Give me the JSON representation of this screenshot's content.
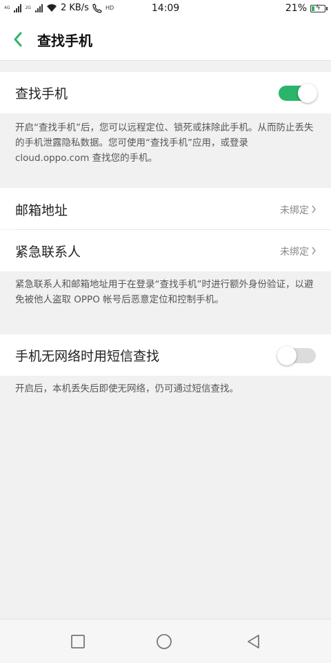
{
  "statusbar": {
    "net_a": "4G",
    "net_b": "2G",
    "speed": "2 KB/s",
    "hd": "HD",
    "time": "14:09",
    "battery": "21%",
    "battery_level": 0.21
  },
  "header": {
    "title": "查找手机"
  },
  "find_phone": {
    "label": "查找手机",
    "enabled": true,
    "description": "开启“查找手机”后，您可以远程定位、锁死或抹除此手机。从而防止丢失的手机泄露隐私数据。您可使用“查找手机”应用，或登录 cloud.oppo.com 查找您的手机。"
  },
  "email": {
    "label": "邮箱地址",
    "value": "未绑定"
  },
  "emergency": {
    "label": "紧急联系人",
    "value": "未绑定",
    "description": "紧急联系人和邮箱地址用于在登录“查找手机”时进行额外身份验证，以避免被他人盗取 OPPO 帐号后恶意定位和控制手机。"
  },
  "sms_find": {
    "label": "手机无网络时用短信查找",
    "enabled": false,
    "description": "开启后，本机丢失后即使无网络，仍可通过短信查找。"
  },
  "colors": {
    "accent": "#2bb56b",
    "background": "#f1f1f1"
  },
  "icons": {
    "back": "chevron-left-icon",
    "chevron": "chevron-right-icon",
    "nav_recent": "square-icon",
    "nav_home": "circle-icon",
    "nav_back": "triangle-back-icon"
  }
}
